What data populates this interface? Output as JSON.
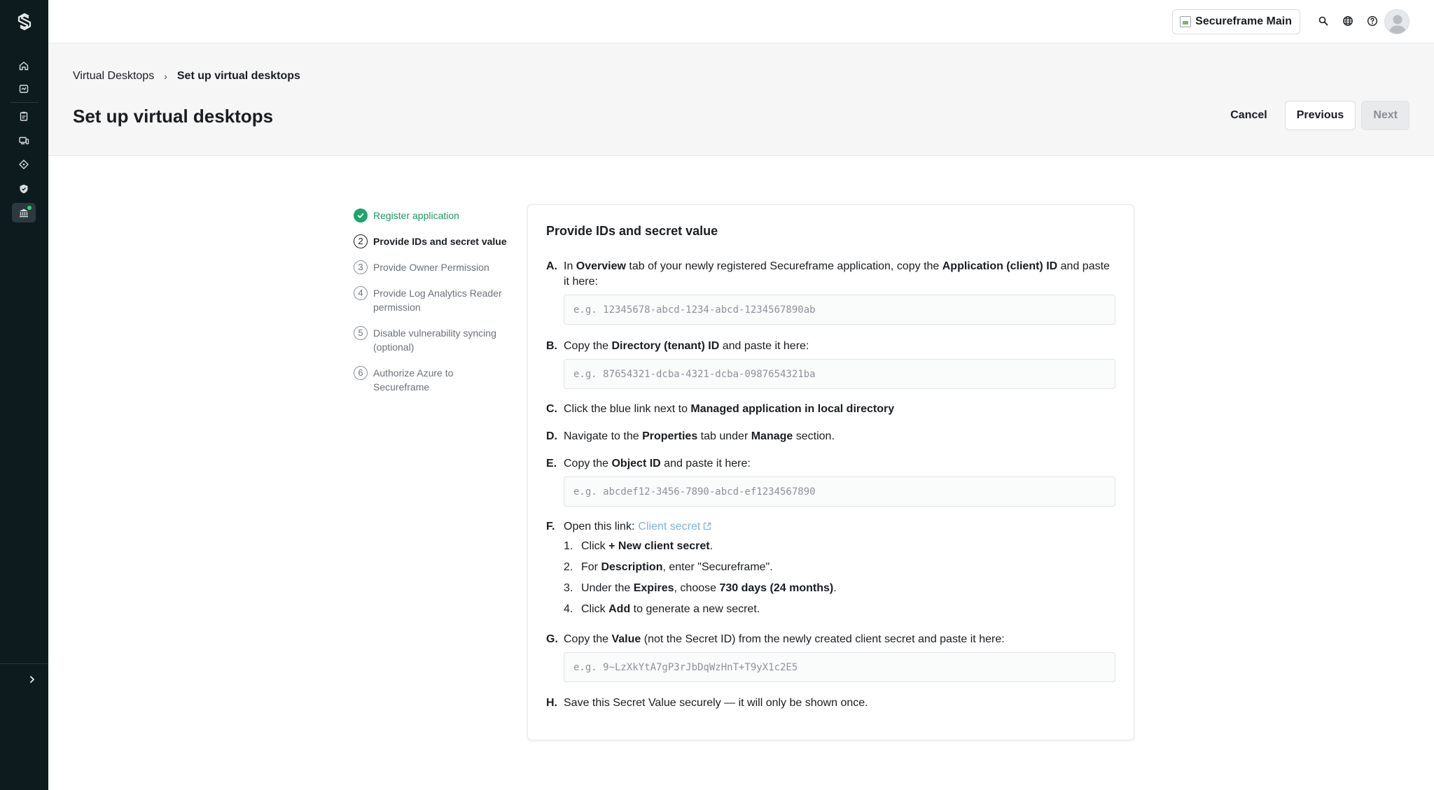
{
  "topbar": {
    "workspace_name": "Secureframe Main"
  },
  "breadcrumb": {
    "parent": "Virtual Desktops",
    "separator": "›",
    "current": "Set up virtual desktops"
  },
  "page": {
    "title": "Set up virtual desktops"
  },
  "actions": {
    "cancel": "Cancel",
    "previous": "Previous",
    "next": "Next"
  },
  "steps": [
    {
      "number": "",
      "label": "Register application",
      "status": "done"
    },
    {
      "number": "2",
      "label": "Provide IDs and secret value",
      "status": "current"
    },
    {
      "number": "3",
      "label": "Provide Owner Permission",
      "status": "pending"
    },
    {
      "number": "4",
      "label": "Provide Log Analytics Reader permission",
      "status": "pending"
    },
    {
      "number": "5",
      "label": "Disable vulnerability syncing (optional)",
      "status": "pending"
    },
    {
      "number": "6",
      "label": "Authorize Azure to Secureframe",
      "status": "pending"
    }
  ],
  "card": {
    "title": "Provide IDs and secret value",
    "a": {
      "letter": "A.",
      "t1": "In ",
      "b1": "Overview",
      "t2": " tab of your newly registered Secureframe application, copy the ",
      "b2": "Application (client) ID",
      "t3": " and paste it here:",
      "placeholder": "e.g. 12345678-abcd-1234-abcd-1234567890ab"
    },
    "b": {
      "letter": "B.",
      "t1": "Copy the ",
      "b1": "Directory (tenant) ID",
      "t2": " and paste it here:",
      "placeholder": "e.g. 87654321-dcba-4321-dcba-0987654321ba"
    },
    "c": {
      "letter": "C.",
      "t1": "Click the blue link next to ",
      "b1": "Managed application in local directory"
    },
    "d": {
      "letter": "D.",
      "t1": "Navigate to the ",
      "b1": "Properties",
      "t2": " tab under ",
      "b2": "Manage",
      "t3": " section."
    },
    "e": {
      "letter": "E.",
      "t1": "Copy the ",
      "b1": "Object ID",
      "t2": " and paste it here:",
      "placeholder": "e.g. abcdef12-3456-7890-abcd-ef1234567890"
    },
    "f": {
      "letter": "F.",
      "t1": "Open this link:",
      "link": "Client secret",
      "subs": [
        {
          "n": "1.",
          "t1": "Click ",
          "b1": "+ New client secret",
          "t2": "."
        },
        {
          "n": "2.",
          "t1": "For ",
          "b1": "Description",
          "t2": ", enter \"Secureframe\"."
        },
        {
          "n": "3.",
          "t1": "Under the ",
          "b1": "Expires",
          "t2": ", choose ",
          "b2": "730 days (24 months)",
          "t3": "."
        },
        {
          "n": "4.",
          "t1": "Click ",
          "b1": "Add",
          "t2": " to generate a new secret."
        }
      ]
    },
    "g": {
      "letter": "G.",
      "t1": "Copy the ",
      "b1": "Value",
      "t2": " (not the Secret ID) from the newly created client secret and paste it here:",
      "placeholder": "e.g. 9~LzXkYtA7gP3rJbDqWzHnT+T9yX1c2E5"
    },
    "h": {
      "letter": "H.",
      "t1": "Save this Secret Value securely — it will only be shown once."
    }
  },
  "colors": {
    "sidebar_bg": "#0d1b1e",
    "success_green": "#1ea56a",
    "link_blue": "#7fb2dd"
  }
}
